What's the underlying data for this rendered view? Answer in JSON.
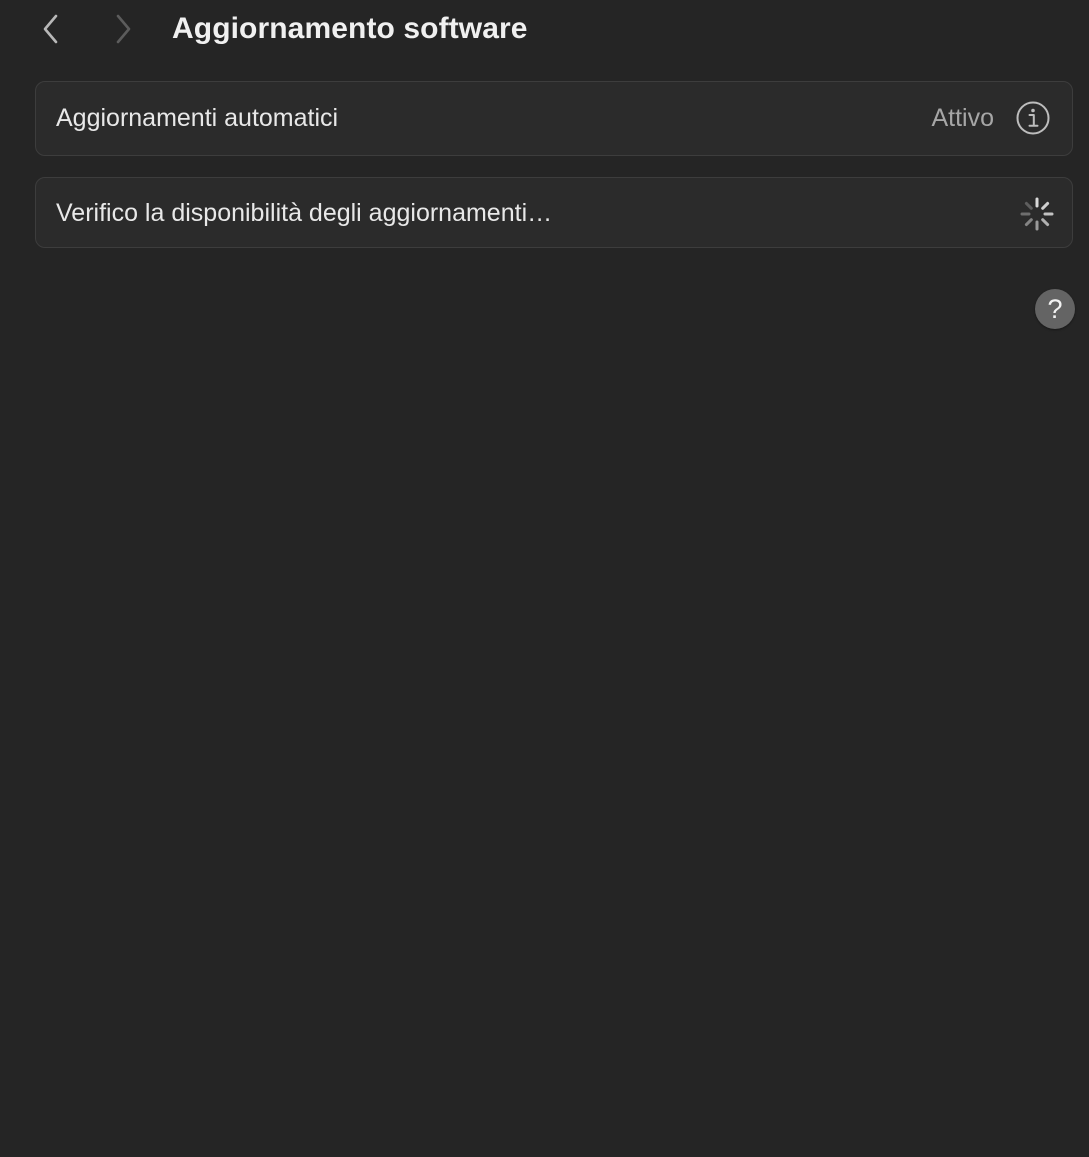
{
  "header": {
    "title": "Aggiornamento software",
    "back_icon": "chevron-left-icon",
    "forward_icon": "chevron-right-icon"
  },
  "automatic_updates": {
    "label": "Aggiornamenti automatici",
    "status": "Attivo",
    "info_icon": "info-icon"
  },
  "check": {
    "label": "Verifico la disponibilità degli aggiornamenti…",
    "spinner_icon": "spinner-icon"
  },
  "help": {
    "glyph": "?",
    "icon": "help-icon"
  },
  "colors": {
    "background": "#252525",
    "card": "#2b2b2b",
    "card_border": "#3d3d3d",
    "secondary_text": "#a6a6a6",
    "help_button": "#646464"
  }
}
